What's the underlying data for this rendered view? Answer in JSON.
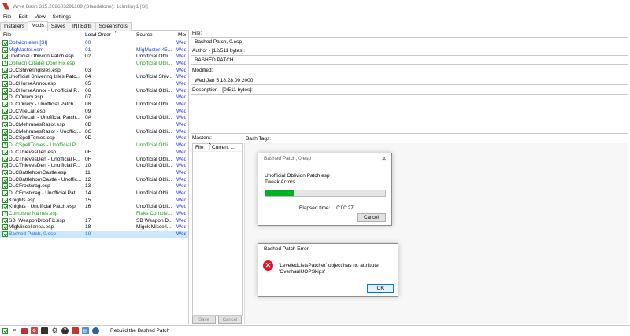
{
  "window": {
    "title": "Wrye Bash 315.202603291109 (Standalone): 1clmlliny1 [SI]"
  },
  "menu": [
    "File",
    "Edit",
    "View",
    "Settings"
  ],
  "tabs": [
    "Installers",
    "Mods",
    "Saves",
    "INI Edits",
    "Screenshots"
  ],
  "active_tab": "Mods",
  "columns": {
    "file": "File",
    "load_order": "Load Order",
    "source": "Source",
    "modified": "Modif"
  },
  "mods": [
    {
      "file": "Oblivion.esm [SI]",
      "order": "00",
      "source": "",
      "mod": "Wed...",
      "color": "blue",
      "check": "check"
    },
    {
      "file": "MigMaster.esm",
      "order": "01",
      "source": "MigMaster-45...",
      "mod": "Wed...",
      "color": "blue",
      "check": "check"
    },
    {
      "file": "Unofficial Oblivion Patch.esp",
      "order": "02",
      "source": "Unofficial Obli...",
      "mod": "Wed...",
      "color": "",
      "check": "check"
    },
    {
      "file": "Oblivion Citadel Door Fix.esp",
      "order": "",
      "source": "Unofficial Obli...",
      "mod": "Wed...",
      "color": "green",
      "check": "plus"
    },
    {
      "file": "DLCShiveringIsles.esp",
      "order": "03",
      "source": "",
      "mod": "Wed...",
      "color": "",
      "check": "check"
    },
    {
      "file": "Unofficial Shivering Isles Patc...",
      "order": "04",
      "source": "Unofficial Shiv...",
      "mod": "Wed...",
      "color": "",
      "check": "check"
    },
    {
      "file": "DLCHorseArmor.esp",
      "order": "05",
      "source": "",
      "mod": "Wed...",
      "color": "",
      "check": "check"
    },
    {
      "file": "DLCHorseArmor - Unofficial P...",
      "order": "06",
      "source": "Unofficial Obli...",
      "mod": "Wed...",
      "color": "",
      "check": "check"
    },
    {
      "file": "DLCOrrery.esp",
      "order": "07",
      "source": "",
      "mod": "Wed...",
      "color": "",
      "check": "check"
    },
    {
      "file": "DLCOrrery - Unofficial Patch.e...",
      "order": "08",
      "source": "Unofficial Obli...",
      "mod": "Wed...",
      "color": "",
      "check": "check"
    },
    {
      "file": "DLCVileLair.esp",
      "order": "09",
      "source": "",
      "mod": "Wed...",
      "color": "",
      "check": "check"
    },
    {
      "file": "DLCVileLair - Unofficial Patch...",
      "order": "0A",
      "source": "Unofficial Obli...",
      "mod": "Wed...",
      "color": "",
      "check": "check"
    },
    {
      "file": "DLCMehrunesRazor.esp",
      "order": "0B",
      "source": "",
      "mod": "Wed...",
      "color": "",
      "check": "check"
    },
    {
      "file": "DLCMehrunesRazor - Unoffici...",
      "order": "0C",
      "source": "Unofficial Obli...",
      "mod": "Wed...",
      "color": "",
      "check": "check"
    },
    {
      "file": "DLCSpellTomes.esp",
      "order": "0D",
      "source": "",
      "mod": "Wed...",
      "color": "",
      "check": "check"
    },
    {
      "file": "DLCSpellTomes - Unofficial P...",
      "order": "",
      "source": "Unofficial Obli...",
      "mod": "Wed...",
      "color": "green",
      "check": "plus"
    },
    {
      "file": "DLCThievesDen.esp",
      "order": "0E",
      "source": "",
      "mod": "Wed...",
      "color": "",
      "check": "check"
    },
    {
      "file": "DLCThievesDen - Unofficial P...",
      "order": "0F",
      "source": "Unofficial Obli...",
      "mod": "Wed...",
      "color": "",
      "check": "check"
    },
    {
      "file": "DLCThievesDen - Unofficial P...",
      "order": "10",
      "source": "Unofficial Obli...",
      "mod": "Wed...",
      "color": "",
      "check": "check"
    },
    {
      "file": "DLCBattlehornCastle.esp",
      "order": "11",
      "source": "",
      "mod": "Wed...",
      "color": "",
      "check": "check"
    },
    {
      "file": "DLCBattlehornCastle - Unoffic...",
      "order": "12",
      "source": "Unofficial Obli...",
      "mod": "Wed...",
      "color": "",
      "check": "check"
    },
    {
      "file": "DLCFrostcrag.esp",
      "order": "13",
      "source": "",
      "mod": "Wed...",
      "color": "",
      "check": "check"
    },
    {
      "file": "DLCFrostcrag - Unofficial Patc...",
      "order": "14",
      "source": "Unofficial Obli...",
      "mod": "Wed...",
      "color": "",
      "check": "check"
    },
    {
      "file": "Knights.esp",
      "order": "15",
      "source": "",
      "mod": "Wed...",
      "color": "",
      "check": "check"
    },
    {
      "file": "Knights - Unofficial Patch.esp",
      "order": "16",
      "source": "Unofficial Obli...",
      "mod": "Wed...",
      "color": "",
      "check": "check"
    },
    {
      "file": "Complete Names.esp",
      "order": "",
      "source": "Flaks Comple...",
      "mod": "Wed...",
      "color": "green",
      "check": "plus"
    },
    {
      "file": "SB_WeaponDropFix.esp",
      "order": "17",
      "source": "SB Weapon D...",
      "mod": "Wed...",
      "color": "",
      "check": "check"
    },
    {
      "file": "MigMiscellanea.esp",
      "order": "18",
      "source": "Migck Miscell...",
      "mod": "Wed...",
      "color": "",
      "check": "check"
    },
    {
      "file": "Bashed Patch, 0.esp",
      "order": "19",
      "source": "",
      "mod": "Wed...",
      "color": "selblue",
      "check": "check"
    }
  ],
  "details": {
    "file_label": "File:",
    "file_value": "Bashed Patch, 0.esp",
    "author_label": "Author - [12/511 bytes]:",
    "author_value": "BASHED PATCH",
    "modified_label": "Modified:",
    "modified_value": "Wed Jan  5 18:28:00 2000",
    "description_label": "Description - [0/511 bytes]:",
    "masters_label": "Masters:",
    "masters_col_file": "File",
    "masters_col_current": "Current ...",
    "bash_tags_label": "Bash Tags:",
    "save_button": "Save",
    "cancel_button": "Cancel"
  },
  "progress_dialog": {
    "title": "Bashed Patch, 0.esp",
    "line1": "Unofficial Oblivion Patch.esp",
    "line2": "Tweak Actors",
    "progress": 0.24,
    "elapsed_label": "Elapsed time:",
    "elapsed_value": "0:00:27",
    "cancel": "Cancel",
    "colors": {
      "fill": "#06b025"
    }
  },
  "error_dialog": {
    "title": "Bashed Patch Error",
    "message_line1": "'LeveledListsPatcher' object has no attribute",
    "message_line2": "'OverhaulUOPSkips'",
    "ok": "OK",
    "icon": "error-x-icon"
  },
  "statusbar": {
    "text": "Rebuild the Bashed Patch"
  }
}
